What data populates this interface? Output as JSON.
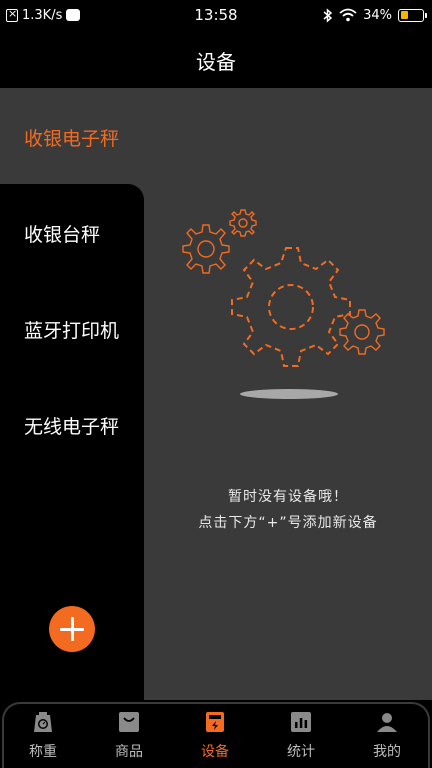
{
  "status_bar": {
    "network_speed": "1.3K/s",
    "time": "13:58",
    "battery_percent": "34%",
    "battery_level": 0.34
  },
  "header": {
    "title": "设备"
  },
  "sidebar": {
    "active_label": "收银电子秤",
    "items": [
      {
        "label": "收银台秤"
      },
      {
        "label": "蓝牙打印机"
      },
      {
        "label": "无线电子秤"
      }
    ]
  },
  "empty_state": {
    "line1": "暂时没有设备哦！",
    "line2": "点击下方“+”号添加新设备"
  },
  "bottom_nav": {
    "items": [
      {
        "label": "称重",
        "icon": "scale-icon",
        "active": false
      },
      {
        "label": "商品",
        "icon": "bag-icon",
        "active": false
      },
      {
        "label": "设备",
        "icon": "device-icon",
        "active": true
      },
      {
        "label": "统计",
        "icon": "stats-icon",
        "active": false
      },
      {
        "label": "我的",
        "icon": "user-icon",
        "active": false
      }
    ]
  },
  "colors": {
    "accent": "#f26b21",
    "panel_grey": "#3a3a3a",
    "background": "#000000"
  }
}
